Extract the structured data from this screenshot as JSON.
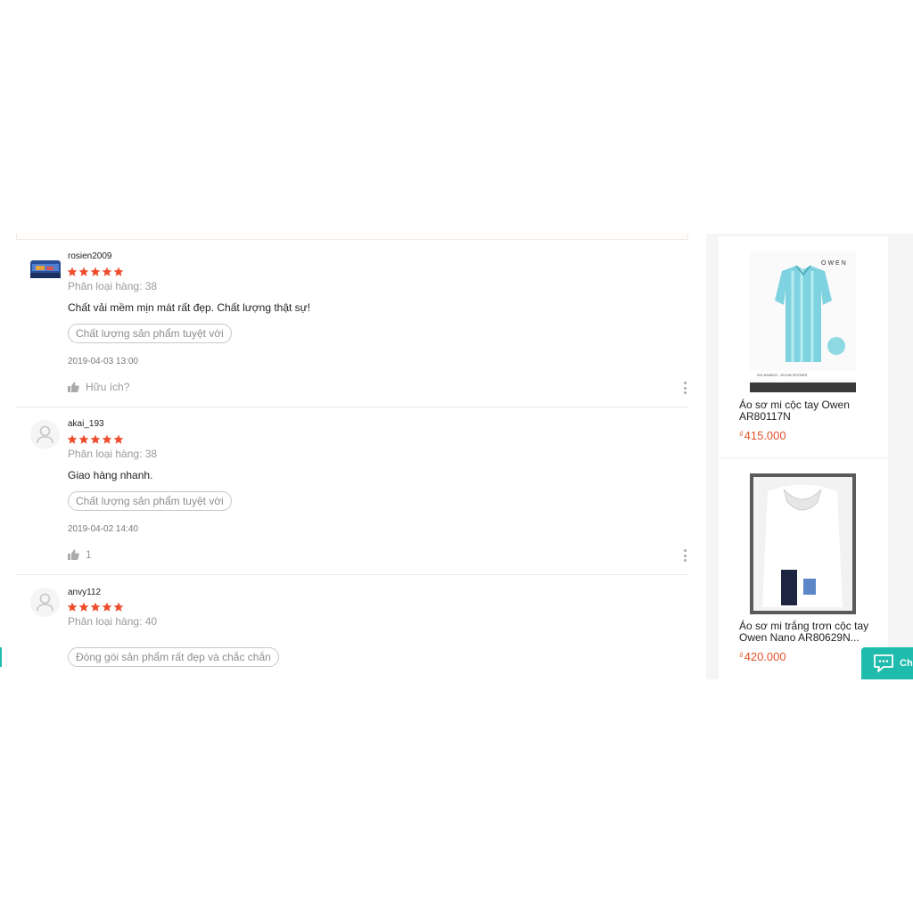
{
  "reviews": [
    {
      "author": "rosien2009",
      "rating": 5,
      "variation": "Phân loại hàng: 38",
      "comment": "Chất vải mềm mịn mát rất đẹp. Chất lượng thật sự!",
      "tag": "Chất lượng sản phẩm tuyệt vời",
      "date": "2019-04-03 13:00",
      "helpful": "Hữu ích?",
      "avatar_icon": "photo-avatar"
    },
    {
      "author": "akai_193",
      "rating": 5,
      "variation": "Phân loại hàng: 38",
      "comment": "Giao hàng nhanh.",
      "tag": "Chất lượng sản phẩm tuyệt vời",
      "date": "2019-04-02 14:40",
      "helpful": "1",
      "avatar_icon": "default-user-icon"
    },
    {
      "author": "anvy112",
      "rating": 5,
      "variation": "Phân loại hàng: 40",
      "comment": "",
      "tag": "Đóng gói sản phẩm rất đẹp và chắc chắn",
      "date": "",
      "helpful": "",
      "avatar_icon": "default-user-icon"
    }
  ],
  "sidebar": {
    "products": [
      {
        "name": "Áo sơ mi cộc tay Owen AR80117N",
        "currency": "₫",
        "price": "415.000",
        "brand_text": "OWEN",
        "label_text": "50% BAMBOO - 50% MICROFIBER"
      },
      {
        "name": "Áo sơ mi trắng trơn cộc tay Owen Nano AR80629N...",
        "currency": "₫",
        "price": "420.000"
      }
    ]
  },
  "chat": {
    "label": "Chat"
  },
  "colors": {
    "star": "#ee4d2d",
    "price": "#e0522d",
    "chat": "#1fbcad"
  }
}
